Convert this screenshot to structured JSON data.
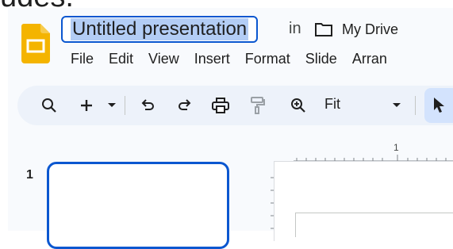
{
  "top_fragment": "udes.",
  "document": {
    "title": "Untitled presentation",
    "location_prefix": "in",
    "location_folder": "My Drive"
  },
  "menu": [
    "File",
    "Edit",
    "View",
    "Insert",
    "Format",
    "Slide",
    "Arran"
  ],
  "toolbar": {
    "zoom_label": "Fit",
    "icons": [
      "search-icon",
      "new-slide-icon",
      "dropdown-icon",
      "undo-icon",
      "redo-icon",
      "print-icon",
      "paint-format-icon",
      "zoom-icon",
      "select-icon"
    ]
  },
  "ruler": {
    "mark": "1"
  },
  "slides": {
    "current_number": "1"
  },
  "colors": {
    "accent": "#0b57d0",
    "selection": "#b3cdf5",
    "logo": "#f4b400",
    "toolbar_bg": "#edf2fa"
  }
}
